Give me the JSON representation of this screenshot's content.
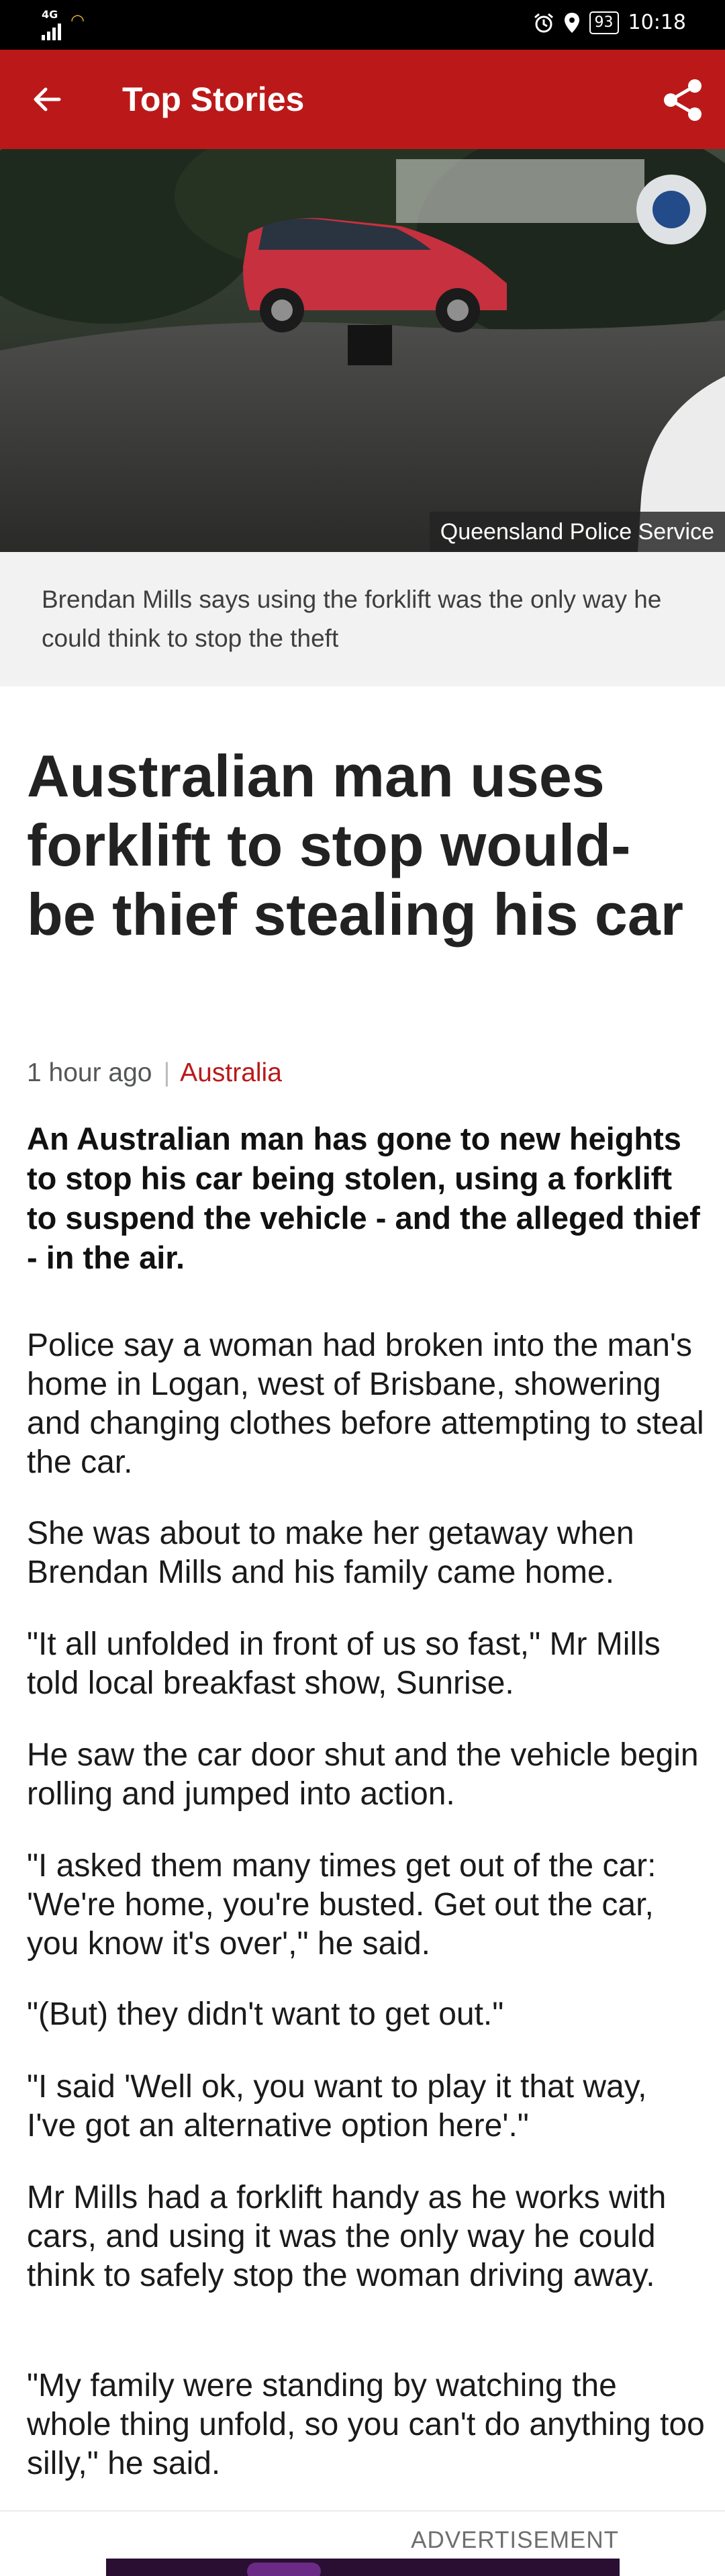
{
  "status_bar": {
    "network": "4G",
    "battery": "93",
    "time": "10:18"
  },
  "app_bar": {
    "title": "Top Stories"
  },
  "hero": {
    "credit": "Queensland Police Service"
  },
  "caption": "Brendan Mills says using the forklift was the only way he could think to stop the theft",
  "article": {
    "headline": "Australian man uses forklift to stop would-be thief stealing his car",
    "timestamp": "1 hour ago",
    "separator": "|",
    "topic": "Australia",
    "intro": "An Australian man has gone to new heights to stop his car being stolen, using a forklift to suspend the vehicle - and the alleged thief - in the air.",
    "paragraphs": [
      "Police say a woman had broken into the man's home in Logan, west of Brisbane, showering and changing clothes before attempting to steal the car.",
      "She was about to make her getaway when Brendan Mills and his family came home.",
      "\"It all unfolded in front of us so fast,\" Mr Mills told local breakfast show, Sunrise.",
      "He saw the car door shut and the vehicle begin rolling and jumped into action.",
      "\"I asked them many times get out of the car: 'We're home, you're busted. Get out the car, you know it's over',\" he said.",
      "\"(But) they didn't want to get out.\"",
      "\"I said 'Well ok, you want to play it that way, I've got an alternative option here'.\"",
      "Mr Mills had a forklift handy as he works with cars, and using it was the only way he could think to safely stop the woman driving away.",
      "\"My family were standing by watching the whole thing unfold, so you can't do anything too silly,\" he said."
    ]
  },
  "advertisement": {
    "label": "ADVERTISEMENT"
  },
  "colors": {
    "accent": "#bb1919",
    "caption_bg": "#f2f2f2",
    "status_bar": "#000000"
  },
  "icons": [
    "back-arrow-icon",
    "share-icon",
    "alarm-icon",
    "location-icon",
    "battery-icon",
    "wifi-icon",
    "signal-icon",
    "police-badge-icon"
  ]
}
